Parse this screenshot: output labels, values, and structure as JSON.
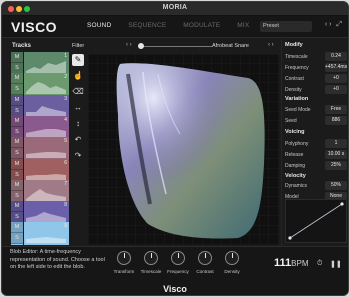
{
  "window": {
    "title": "MORIA"
  },
  "header": {
    "logo": "VISCO",
    "tabs": [
      {
        "label": "SOUND",
        "active": true
      },
      {
        "label": "SEQUENCE",
        "active": false
      },
      {
        "label": "MODULATE",
        "active": false
      },
      {
        "label": "MIX",
        "active": false
      }
    ],
    "preset": "Preset",
    "arrows": "‹ ›"
  },
  "tracks": {
    "title": "Tracks",
    "items": [
      {
        "number": "1",
        "color": "#5d8a6a",
        "mute": "M",
        "solo": "S"
      },
      {
        "number": "2",
        "color": "#6a9a6e",
        "mute": "M",
        "solo": "S"
      },
      {
        "number": "3",
        "color": "#6b5fa0",
        "mute": "M",
        "solo": "S"
      },
      {
        "number": "4",
        "color": "#8a5a8e",
        "mute": "M",
        "solo": "S"
      },
      {
        "number": "5",
        "color": "#9a6a7a",
        "mute": "M",
        "solo": "S"
      },
      {
        "number": "6",
        "color": "#a05f60",
        "mute": "M",
        "solo": "S"
      },
      {
        "number": "7",
        "color": "#a07a86",
        "mute": "M",
        "solo": "S"
      },
      {
        "number": "8",
        "color": "#6a5fa8",
        "mute": "M",
        "solo": "S"
      },
      {
        "number": "9",
        "color": "#8fc6ea",
        "mute": "M",
        "solo": "S"
      }
    ]
  },
  "editor": {
    "filter_label": "Filter",
    "source_name": "Afrobeat Snare",
    "arrows": "‹ ›"
  },
  "params": {
    "modify": {
      "title": "Modify",
      "rows": [
        {
          "label": "Timescale",
          "value": "0.24"
        },
        {
          "label": "Frequency",
          "value": "+457.4ms"
        },
        {
          "label": "Contrast",
          "value": "+0"
        },
        {
          "label": "Density",
          "value": "+0"
        }
      ]
    },
    "variation": {
      "title": "Variation",
      "rows": [
        {
          "label": "Seed Mode",
          "value": "Free"
        },
        {
          "label": "Seed",
          "value": "886"
        }
      ]
    },
    "voicing": {
      "title": "Voicing",
      "rows": [
        {
          "label": "Polyphony",
          "value": "1"
        },
        {
          "label": "Release",
          "value": "10.00 s"
        },
        {
          "label": "Damping",
          "value": "25%"
        }
      ]
    },
    "velocity": {
      "title": "Velocity",
      "rows": [
        {
          "label": "Dynamics",
          "value": "50%"
        },
        {
          "label": "Model",
          "value": "None"
        }
      ]
    }
  },
  "bottom": {
    "help_text": "Blob Editor: A time-frequency representation of sound. Choose a tool on the left side to edit the blob.",
    "knobs": [
      "Transform",
      "Timescale",
      "Frequency",
      "Contrast",
      "Density"
    ],
    "bpm_value": "111",
    "bpm_unit": "BPM",
    "footer_logo": "Visco"
  },
  "colors": {
    "background": "#1b1b1b",
    "selected_track": "#8fc6ea",
    "text": "#d8d8d8"
  }
}
